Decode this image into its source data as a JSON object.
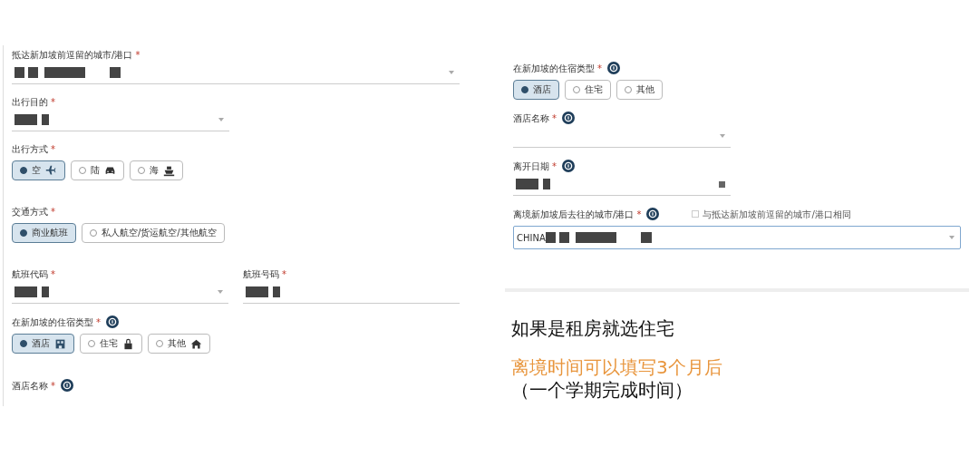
{
  "left_form": [
    {
      "kind": "select",
      "label": "抵达新加坡前逗留的城市/港口",
      "required_mark": "*",
      "redacted": true,
      "wide": true
    },
    {
      "kind": "select",
      "label": "出行目的",
      "required_mark": "*",
      "redacted": true
    },
    {
      "kind": "radio",
      "label": "出行方式",
      "required_mark": "*",
      "options": [
        {
          "label": "空",
          "selected": true
        },
        {
          "label": "陆",
          "selected": false
        },
        {
          "label": "海",
          "selected": false
        }
      ]
    },
    {
      "kind": "radio",
      "label": "交通方式",
      "required_mark": "*",
      "options": [
        {
          "label": "商业航班",
          "selected": true
        },
        {
          "label": "私人航空/货运航空/其他航空",
          "selected": false
        }
      ]
    },
    {
      "kind": "pair",
      "items": [
        {
          "kind": "select",
          "label": "航班代码",
          "required_mark": "*",
          "redacted": true
        },
        {
          "kind": "text",
          "label": "航班号码",
          "required_mark": "*",
          "redacted": true
        }
      ]
    },
    {
      "kind": "radio",
      "label": "在新加坡的住宿类型",
      "required_mark": "*",
      "info": true,
      "options": [
        {
          "label": "酒店",
          "selected": true
        },
        {
          "label": "住宅",
          "selected": false
        },
        {
          "label": "其他",
          "selected": false
        }
      ]
    },
    {
      "kind": "heading",
      "label": "酒店名称",
      "required_mark": "*",
      "info": true
    }
  ],
  "right_form": [
    {
      "kind": "radio",
      "label": "在新加坡的住宿类型",
      "required_mark": "*",
      "info": true,
      "options": [
        {
          "label": "酒店",
          "selected": true
        },
        {
          "label": "住宅",
          "selected": false
        },
        {
          "label": "其他",
          "selected": false
        }
      ]
    },
    {
      "kind": "select",
      "label": "酒店名称",
      "required_mark": "*",
      "info": true
    },
    {
      "kind": "date",
      "label": "离开日期",
      "required_mark": "*",
      "info": true,
      "redacted": true
    },
    {
      "kind": "select",
      "label": "离境新加坡后去往的城市/港口",
      "required_mark": "*",
      "info": true,
      "redacted": true,
      "wide": true,
      "focused": true,
      "value": "CHINA",
      "same_as": {
        "label": "与抵达新加坡前逗留的城市/港口相同",
        "checked": false
      }
    }
  ],
  "notes": [
    {
      "text": "如果是租房就选住宅",
      "color": "#111111"
    },
    {
      "text": "离境时间可以填写3个月后",
      "color": "#e8953c"
    },
    {
      "text": "（一个学期完成时间）",
      "color": "#111111"
    }
  ]
}
